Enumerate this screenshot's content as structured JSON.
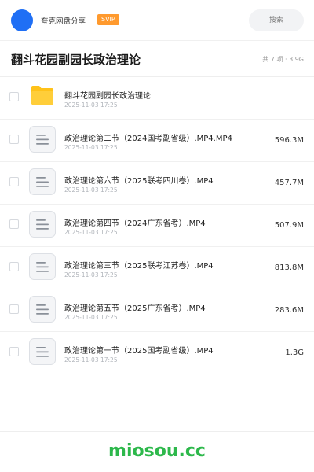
{
  "header": {
    "share_name": "夸克网盘分享",
    "badge": "SVIP",
    "search_placeholder": "搜索"
  },
  "title_bar": {
    "title": "翻斗花园副园长政治理论",
    "summary": "共 7 项 · 3.9G"
  },
  "files": [
    {
      "type": "folder",
      "name": "翻斗花园副园长政治理论",
      "date": "2025-11-03 17:25",
      "size": ""
    },
    {
      "type": "file",
      "name": "政治理论第二节（2024国考副省级）.MP4.MP4",
      "date": "2025-11-03 17:25",
      "size": "596.3M"
    },
    {
      "type": "file",
      "name": "政治理论第六节（2025联考四川卷）.MP4",
      "date": "2025-11-03 17:25",
      "size": "457.7M"
    },
    {
      "type": "file",
      "name": "政治理论第四节（2024广东省考）.MP4",
      "date": "2025-11-03 17:25",
      "size": "507.9M"
    },
    {
      "type": "file",
      "name": "政治理论第三节（2025联考江苏卷）.MP4",
      "date": "2025-11-03 17:25",
      "size": "813.8M"
    },
    {
      "type": "file",
      "name": "政治理论第五节（2025广东省考）.MP4",
      "date": "2025-11-03 17:25",
      "size": "283.6M"
    },
    {
      "type": "file",
      "name": "政治理论第一节（2025国考副省级）.MP4",
      "date": "2025-11-03 17:25",
      "size": "1.3G"
    }
  ],
  "footer": {
    "brand": "miosou.cc"
  },
  "colors": {
    "avatar": "#1f6ff5",
    "badge": "#ff9a2e",
    "folder": "#ffc21a",
    "brand": "#2db84b"
  },
  "icons": {
    "folder": "folder-icon",
    "file": "file-icon"
  }
}
